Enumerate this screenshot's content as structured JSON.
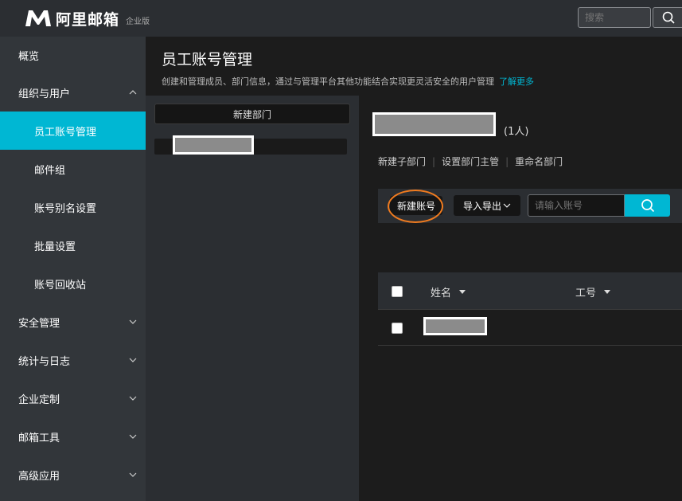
{
  "topbar": {
    "logo_text": "阿里邮箱",
    "logo_edition": "企业版",
    "search_placeholder": "搜索"
  },
  "sidebar": {
    "items": [
      {
        "label": "概览"
      },
      {
        "label": "组织与用户",
        "expanded": true
      },
      {
        "label": "员工账号管理",
        "active": true
      },
      {
        "label": "邮件组"
      },
      {
        "label": "账号别名设置"
      },
      {
        "label": "批量设置"
      },
      {
        "label": "账号回收站"
      },
      {
        "label": "安全管理"
      },
      {
        "label": "统计与日志"
      },
      {
        "label": "企业定制"
      },
      {
        "label": "邮箱工具"
      },
      {
        "label": "高级应用"
      }
    ]
  },
  "header": {
    "title": "员工账号管理",
    "description": "创建和管理成员、部门信息，通过与管理平台其他功能结合实现更灵活安全的用户管理",
    "learn_more": "了解更多"
  },
  "dept_panel": {
    "new_dept_label": "新建部门"
  },
  "main": {
    "member_count": "(1人)",
    "actions": {
      "add_sub_dept": "新建子部门",
      "set_dept_manager": "设置部门主管",
      "rename_dept": "重命名部门"
    },
    "toolbar": {
      "new_account": "新建账号",
      "import_export": "导入导出",
      "account_placeholder": "请输入账号"
    },
    "table": {
      "col_name": "姓名",
      "col_id": "工号"
    }
  },
  "colors": {
    "accent": "#00b7d3",
    "annotation": "#f07b1f",
    "sidebar_bg": "#32363a"
  }
}
